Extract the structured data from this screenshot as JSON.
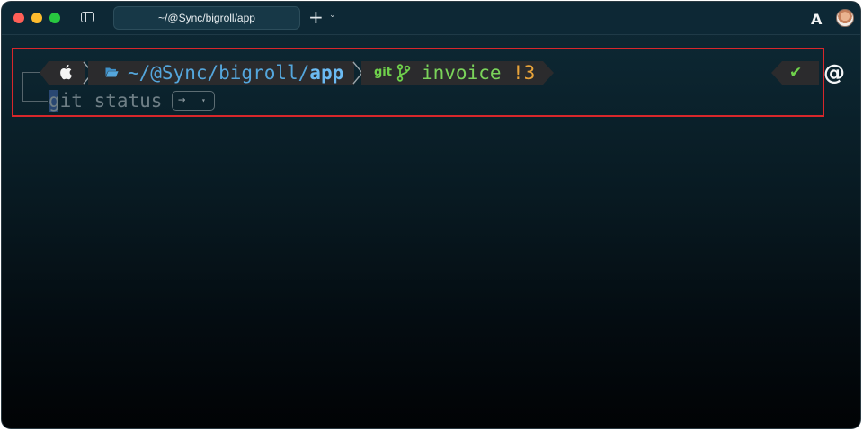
{
  "window": {
    "tab_title": "~/@Sync/bigroll/app",
    "new_tab_glyph": "+",
    "new_tab_menu_glyph": "⌄",
    "app_logo_glyph": "A"
  },
  "prompt": {
    "os_icon": "apple-icon",
    "path_prefix": "~/@Sync/bigroll/",
    "path_current": "app",
    "git_label": "git",
    "branch_name": "invoice",
    "git_status": "!3",
    "status_glyph": "✔",
    "right_glyph": "@"
  },
  "command": {
    "typed_text": "git status",
    "suggestion_arrow": "→",
    "suggestion_caret": "▾"
  },
  "colors": {
    "path": "#54a6dc",
    "branch": "#7ad35a",
    "dirty": "#e8a33a",
    "highlight": "#d8272b"
  }
}
